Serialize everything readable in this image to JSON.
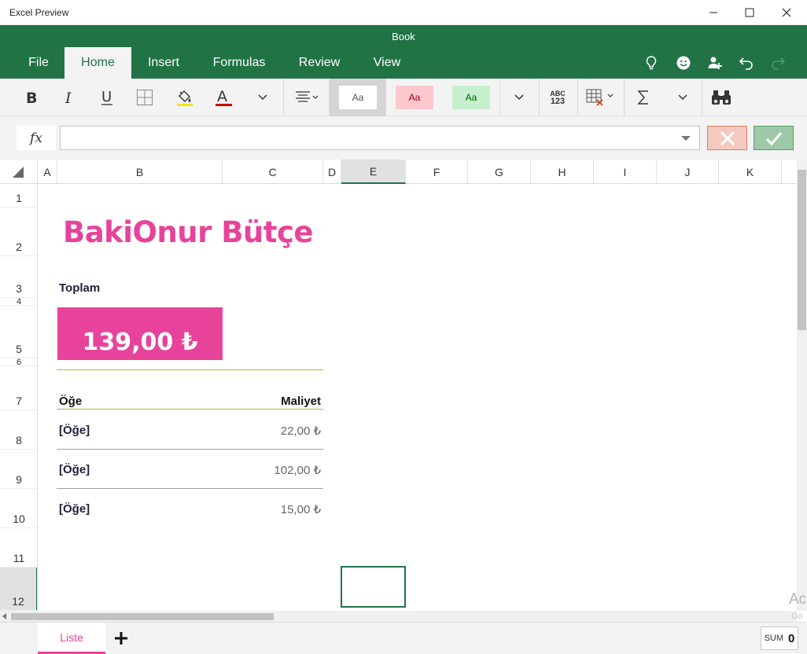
{
  "window": {
    "app_title": "Excel Preview",
    "doc_title": "Book"
  },
  "ribbon_tabs": [
    {
      "label": "File",
      "active": false
    },
    {
      "label": "Home",
      "active": true
    },
    {
      "label": "Insert",
      "active": false
    },
    {
      "label": "Formulas",
      "active": false
    },
    {
      "label": "Review",
      "active": false
    },
    {
      "label": "View",
      "active": false
    }
  ],
  "ribbon": {
    "cell_style_label": "Aa",
    "number_format": {
      "line1": "ABC",
      "line2": "123"
    }
  },
  "formula_bar": {
    "fx_label": "fx",
    "value": ""
  },
  "columns": [
    "A",
    "B",
    "C",
    "D",
    "E",
    "F",
    "G",
    "H",
    "I",
    "J",
    "K"
  ],
  "selected_column": "E",
  "rows": [
    "1",
    "2",
    "3",
    "4",
    "5",
    "6",
    "7",
    "8",
    "9",
    "10",
    "11",
    "12"
  ],
  "selected_row": "12",
  "sheet": {
    "title": "BakiOnur Bütçe",
    "total_label": "Toplam",
    "total_value": "139,00 ₺",
    "item_header": "Öğe",
    "cost_header": "Maliyet",
    "items": [
      {
        "name": "[Öğe]",
        "cost": "22,00 ₺"
      },
      {
        "name": "[Öğe]",
        "cost": "102,00 ₺"
      },
      {
        "name": "[Öğe]",
        "cost": "15,00 ₺"
      }
    ]
  },
  "sheet_tabs": {
    "active": "Liste"
  },
  "status": {
    "sum_label": "SUM",
    "sum_value": "0"
  },
  "watermark": {
    "line1": "Ac",
    "line2": "Go"
  },
  "colors": {
    "brand_green": "#217346",
    "accent_pink": "#e8439b",
    "gold_rule": "#c9a640"
  }
}
